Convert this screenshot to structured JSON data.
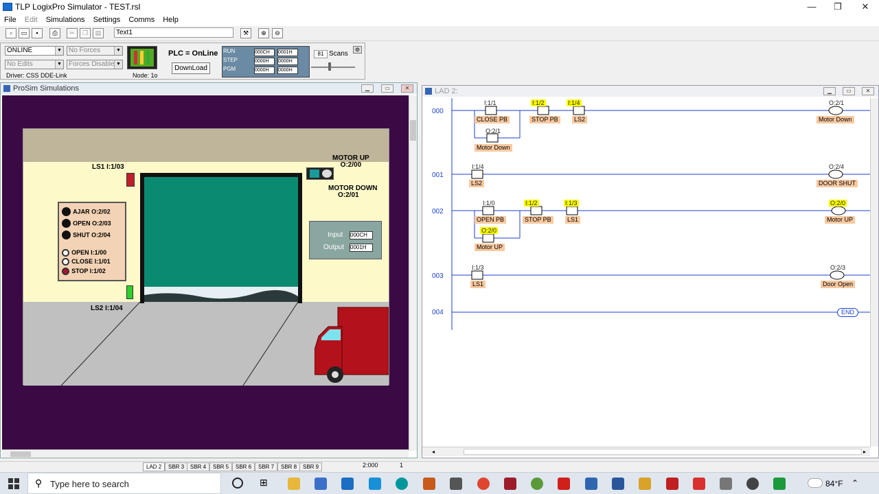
{
  "app": {
    "title": "TLP LogixPro Simulator  -  TEST.rsl"
  },
  "menu": [
    "File",
    "Edit",
    "Simulations",
    "Settings",
    "Comms",
    "Help"
  ],
  "toolbar": {
    "text_field": "Text1"
  },
  "status": {
    "mode": "ONLINE",
    "forces": "No Forces",
    "edits": "No Edits",
    "forces_state": "Forces Disabled",
    "driver": "Driver: CSS DDE-Link",
    "node": "Node: 1o",
    "plc_state": "PLC = OnLine",
    "download": "DownLoad",
    "run": "RUN",
    "step": "STEP",
    "pgm": "PGM",
    "reg": [
      "000CH",
      "0001H",
      "0000H",
      "0000H",
      "0000H",
      "0000H"
    ],
    "scans_count": "81",
    "scans_label": "Scans"
  },
  "prosim": {
    "title": "ProSim Simulations",
    "ls1": "LS1  I:1/03",
    "ls2": "LS2  I:1/04",
    "motor_up_1": "MOTOR UP",
    "motor_up_2": "O:2/00",
    "motor_down_1": "MOTOR DOWN",
    "motor_down_2": "O:2/01",
    "panel": [
      {
        "label": "AJAR  O:2/02",
        "kind": "lamp"
      },
      {
        "label": "OPEN  O:2/03",
        "kind": "lamp"
      },
      {
        "label": "SHUT  O:2/04",
        "kind": "lamp"
      },
      {
        "label": "OPEN    I:1/00",
        "kind": "btn"
      },
      {
        "label": "CLOSE I:1/01",
        "kind": "btn"
      },
      {
        "label": "STOP   I:1/02",
        "kind": "btnred"
      }
    ],
    "io_input_label": "Input",
    "io_input_val": "000CH",
    "io_output_label": "Output",
    "io_output_val": "0001H"
  },
  "lad": {
    "title": "LAD 2:",
    "rungs": [
      {
        "no": "000"
      },
      {
        "no": "001"
      },
      {
        "no": "002"
      },
      {
        "no": "003"
      },
      {
        "no": "004"
      }
    ],
    "labels": {
      "r0_a1": "I:1/1",
      "r0_n1": "CLOSE PB",
      "r0_a2": "I:1/2",
      "r0_n2": "STOP PB",
      "r0_a3": "I:1/4",
      "r0_n3": "LS2",
      "r0_a4": "O:2/1",
      "r0_n4": "Motor Down",
      "r0_ao": "O:2/1",
      "r0_no": "Motor Down",
      "r1_a1": "I:1/4",
      "r1_n1": "LS2",
      "r1_ao": "O:2/4",
      "r1_no": "DOOR SHUT",
      "r2_a1": "I:1/0",
      "r2_n1": "OPEN PB",
      "r2_a2": "I:1/2",
      "r2_n2": "STOP PB",
      "r2_a3": "I:1/3",
      "r2_n3": "LS1",
      "r2_a4": "O:2/0",
      "r2_n4": "Motor UP",
      "r2_ao": "O:2/0",
      "r2_no": "Motor UP",
      "r3_a1": "I:1/3",
      "r3_n1": "LS1",
      "r3_ao": "O:2/3",
      "r3_no": "Door Open",
      "end": "END"
    }
  },
  "tabs": [
    "LAD 2",
    "SBR 3",
    "SBR 4",
    "SBR 5",
    "SBR 6",
    "SBR 7",
    "SBR 8",
    "SBR 9"
  ],
  "statusbar": {
    "coords": "2:000",
    "val": "1"
  },
  "taskbar": {
    "search": "Type here to search",
    "temp": "84°F"
  }
}
